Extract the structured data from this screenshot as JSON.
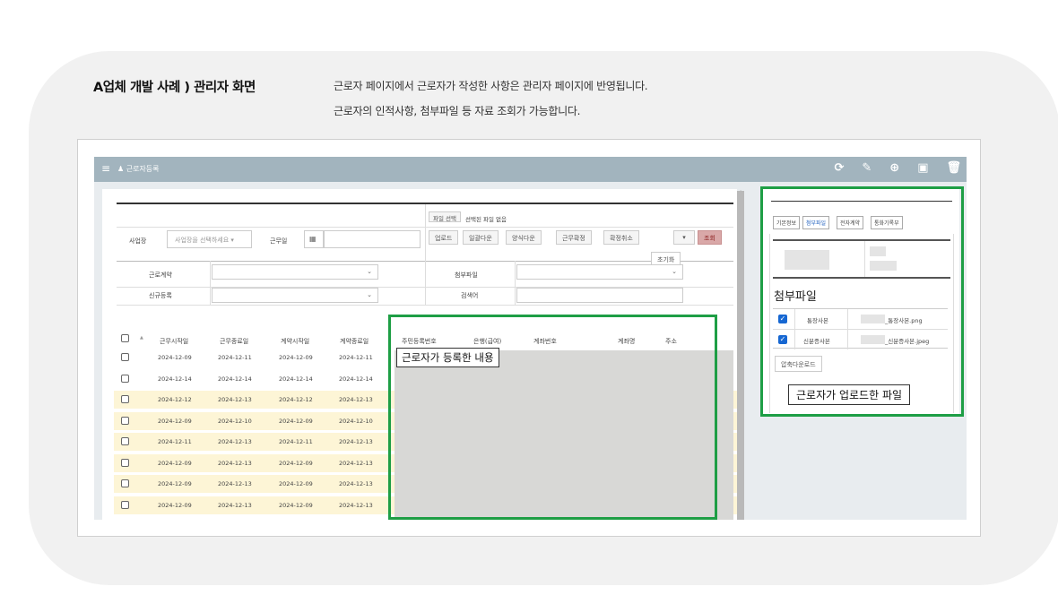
{
  "header": {
    "title": "A업체 개발 사례 ) 관리자 화면",
    "desc_line1": "근로자 페이지에서 근로자가 작성한 사항은 관리자 페이지에 반영됩니다.",
    "desc_line2": "근로자의 인적사항, 첨부파일 등 자료 조회가 가능합니다."
  },
  "app": {
    "menu_icon": "≡",
    "title": "♟ 근로자등록",
    "toolbar_icons": [
      "refresh-icon",
      "edit-icon",
      "add-icon",
      "save-icon",
      "delete-icon"
    ]
  },
  "filters": {
    "workplace_label": "사업장",
    "workplace_placeholder": "사업장을 선택하세요 ▾",
    "workday_label": "근무일",
    "file_select_btn": "파일 선택",
    "file_status": "선택된 파일 없음",
    "buttons": [
      "업로드",
      "일괄다운",
      "양식다운",
      "근무확정",
      "확정취소"
    ],
    "dropdown_caret": "▾",
    "search_btn": "조회",
    "reset_btn": "초기화",
    "contract_label": "근로계약",
    "attach_label": "첨부파일",
    "newreg_label": "신규등록",
    "keyword_label": "검색어"
  },
  "table": {
    "headers": [
      "근무시작일",
      "근무종료일",
      "계약시작일",
      "계약종료일",
      "주민등록번호",
      "은행(급여)",
      "계좌번호",
      "계좌명",
      "주소"
    ],
    "rows": [
      {
        "cells": [
          "2024-12-09",
          "2024-12-11",
          "2024-12-09",
          "2024-12-11"
        ],
        "highlight": false
      },
      {
        "cells": [
          "2024-12-14",
          "2024-12-14",
          "2024-12-14",
          "2024-12-14"
        ],
        "highlight": false
      },
      {
        "cells": [
          "2024-12-12",
          "2024-12-13",
          "2024-12-12",
          "2024-12-13"
        ],
        "highlight": true
      },
      {
        "cells": [
          "2024-12-09",
          "2024-12-10",
          "2024-12-09",
          "2024-12-10"
        ],
        "highlight": true
      },
      {
        "cells": [
          "2024-12-11",
          "2024-12-13",
          "2024-12-11",
          "2024-12-13"
        ],
        "highlight": true
      },
      {
        "cells": [
          "2024-12-09",
          "2024-12-13",
          "2024-12-09",
          "2024-12-13"
        ],
        "highlight": true
      },
      {
        "cells": [
          "2024-12-09",
          "2024-12-13",
          "2024-12-09",
          "2024-12-13"
        ],
        "highlight": true
      },
      {
        "cells": [
          "2024-12-09",
          "2024-12-13",
          "2024-12-09",
          "2024-12-13"
        ],
        "highlight": true
      }
    ],
    "callout": "근로자가 등록한 내용"
  },
  "side": {
    "tabs": [
      "기본정보",
      "첨부파일",
      "전자계약",
      "통화기록부"
    ],
    "active_tab": 1,
    "section_title": "첨부파일",
    "files": [
      {
        "type": "통장사본",
        "name": "_통장사본.png"
      },
      {
        "type": "신분증사본",
        "name": "_신분증사본.jpeg"
      }
    ],
    "zip_btn": "압축다운로드",
    "callout": "근로자가 업로드한 파일"
  },
  "colors": {
    "accent_green": "#1e9e45",
    "topbar": "#a2b4be",
    "check_blue": "#1667d2",
    "highlight_row": "#fdf5d6"
  }
}
